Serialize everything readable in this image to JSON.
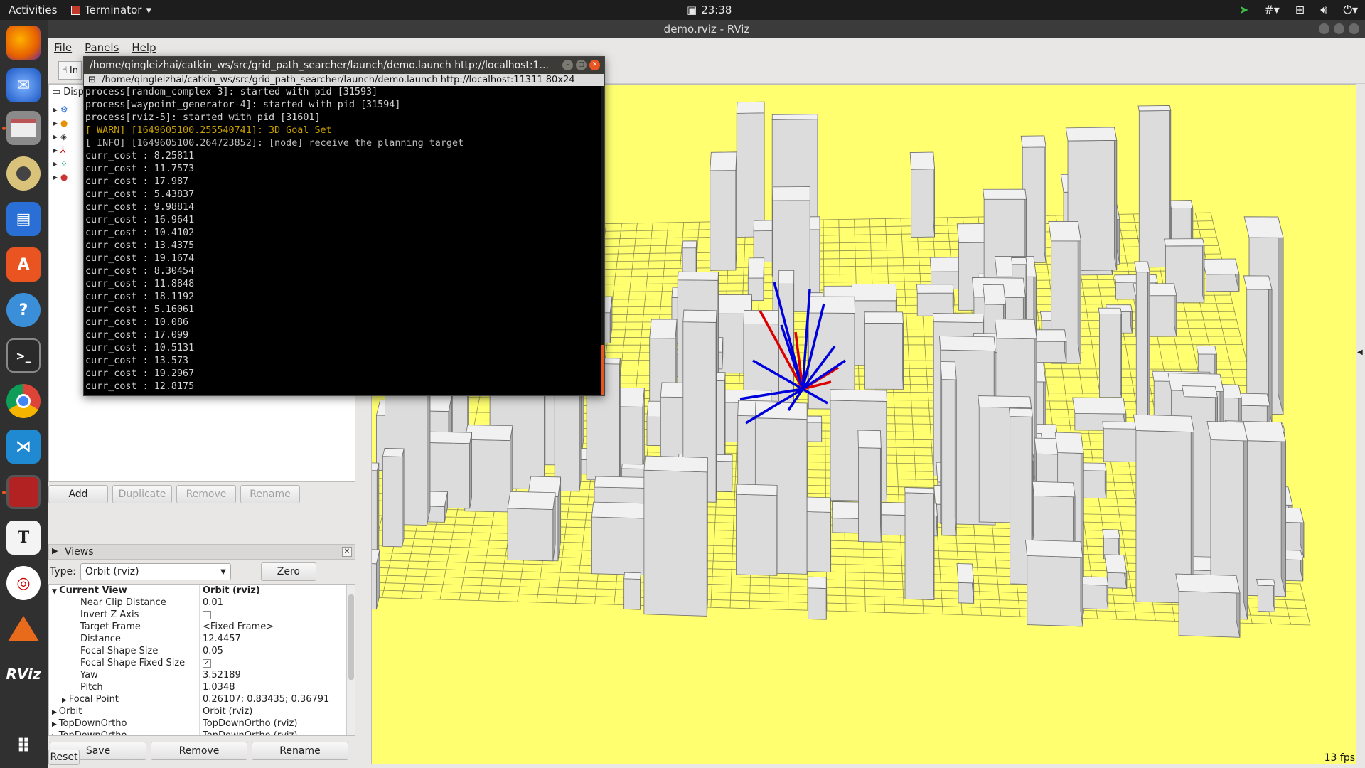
{
  "topbar": {
    "activities": "Activities",
    "app_name": "Terminator",
    "clock": "23:38"
  },
  "window": {
    "title": "demo.rviz - RViz"
  },
  "menu": [
    "File",
    "Panels",
    "Help"
  ],
  "toolbar": {
    "interact_label": "In"
  },
  "displays": {
    "title": "Disp"
  },
  "display_buttons": {
    "add": "Add",
    "duplicate": "Duplicate",
    "remove": "Remove",
    "rename": "Rename"
  },
  "views": {
    "title": "Views",
    "type_label": "Type:",
    "type_value": "Orbit (rviz)",
    "zero": "Zero",
    "rows": [
      {
        "k": "Current View",
        "v": "Orbit (rviz)",
        "indent": 0,
        "arrow": "▼",
        "bold": true
      },
      {
        "k": "Near Clip Distance",
        "v": "0.01",
        "indent": 2
      },
      {
        "k": "Invert Z Axis",
        "v": "",
        "indent": 2,
        "check": "unchecked"
      },
      {
        "k": "Target Frame",
        "v": "<Fixed Frame>",
        "indent": 2
      },
      {
        "k": "Distance",
        "v": "12.4457",
        "indent": 2
      },
      {
        "k": "Focal Shape Size",
        "v": "0.05",
        "indent": 2
      },
      {
        "k": "Focal Shape Fixed Size",
        "v": "",
        "indent": 2,
        "check": "checked"
      },
      {
        "k": "Yaw",
        "v": "3.52189",
        "indent": 2
      },
      {
        "k": "Pitch",
        "v": "1.0348",
        "indent": 2
      },
      {
        "k": "Focal Point",
        "v": "0.26107; 0.83435; 0.36791",
        "indent": 1,
        "arrow": "▶"
      },
      {
        "k": "Orbit",
        "v": "Orbit (rviz)",
        "indent": 0,
        "arrow": "▶"
      },
      {
        "k": "TopDownOrtho",
        "v": "TopDownOrtho (rviz)",
        "indent": 0,
        "arrow": "▶"
      },
      {
        "k": "TopDownOrtho",
        "v": "TopDownOrtho (rviz)",
        "indent": 0,
        "arrow": "▶"
      }
    ],
    "save": "Save",
    "remove": "Remove",
    "rename": "Rename"
  },
  "reset": "Reset",
  "fps": "13 fps",
  "terminal": {
    "title": "/home/qingleizhai/catkin_ws/src/grid_path_searcher/launch/demo.launch http://localhost:1...",
    "tab": "/home/qingleizhai/catkin_ws/src/grid_path_searcher/launch/demo.launch http://localhost:11311 80x24",
    "lines": [
      {
        "t": "process[random_complex-3]: started with pid [31593]",
        "c": "n"
      },
      {
        "t": "process[waypoint_generator-4]: started with pid [31594]",
        "c": "n"
      },
      {
        "t": "process[rviz-5]: started with pid [31601]",
        "c": "n"
      },
      {
        "t": "[ WARN] [1649605100.255540741]: 3D Goal Set",
        "c": "warn"
      },
      {
        "t": "[ INFO] [1649605100.264723852]: [node] receive the planning target",
        "c": "info"
      },
      {
        "t": "curr_cost : 8.25811",
        "c": "n"
      },
      {
        "t": "curr_cost : 11.7573",
        "c": "n"
      },
      {
        "t": "curr_cost : 17.987",
        "c": "n"
      },
      {
        "t": "curr_cost : 5.43837",
        "c": "n"
      },
      {
        "t": "curr_cost : 9.98814",
        "c": "n"
      },
      {
        "t": "curr_cost : 16.9641",
        "c": "n"
      },
      {
        "t": "curr_cost : 10.4102",
        "c": "n"
      },
      {
        "t": "curr_cost : 13.4375",
        "c": "n"
      },
      {
        "t": "curr_cost : 19.1674",
        "c": "n"
      },
      {
        "t": "curr_cost : 8.30454",
        "c": "n"
      },
      {
        "t": "curr_cost : 11.8848",
        "c": "n"
      },
      {
        "t": "curr_cost : 18.1192",
        "c": "n"
      },
      {
        "t": "curr_cost : 5.16061",
        "c": "n"
      },
      {
        "t": "curr_cost : 10.086",
        "c": "n"
      },
      {
        "t": "curr_cost : 17.099",
        "c": "n"
      },
      {
        "t": "curr_cost : 10.5131",
        "c": "n"
      },
      {
        "t": "curr_cost : 13.573",
        "c": "n"
      },
      {
        "t": "curr_cost : 19.2967",
        "c": "n"
      },
      {
        "t": "curr_cost : 12.8175",
        "c": "n"
      }
    ]
  },
  "colors": {
    "viewport_bg": "#ffff70",
    "accent": "#e95420",
    "warn": "#c8a000",
    "ray_blue": "#0000dd",
    "ray_red": "#dd0000"
  },
  "dock_icons": [
    "firefox-icon",
    "thunderbird-icon",
    "files-icon",
    "rhythmbox-icon",
    "writer-icon",
    "software-center-icon",
    "help-icon",
    "terminal-icon",
    "chrome-icon",
    "vscode-icon",
    "terminator-icon",
    "typora-icon",
    "xmind-icon",
    "matlab-icon",
    "rviz-icon",
    "app-grid-icon"
  ]
}
